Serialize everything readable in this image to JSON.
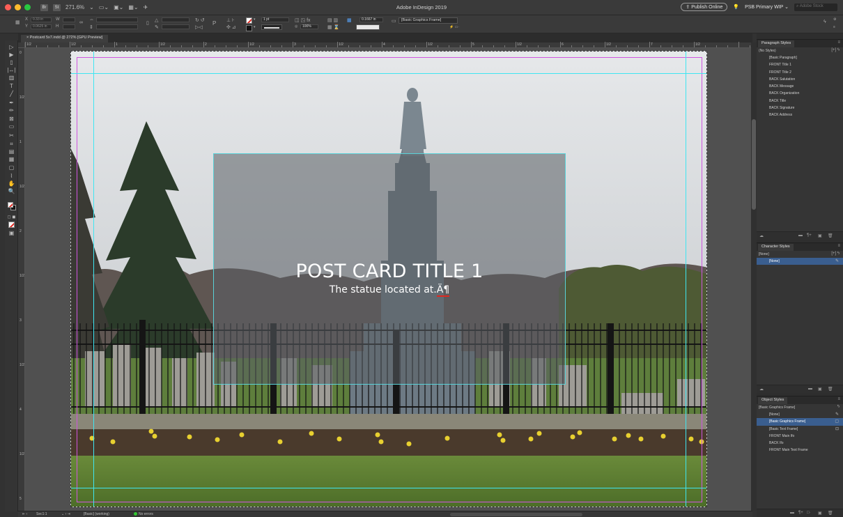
{
  "app": {
    "title": "Adobe InDesign 2019",
    "zoom": "271.6%",
    "publish_label": "Publish Online",
    "workspace": "PSB Primary WIP",
    "search_placeholder": "Adobe Stock"
  },
  "control_bar": {
    "x_value": "0.33 in",
    "y_value": "0.0625 in",
    "stroke_weight": "1 pt",
    "opacity": "100%",
    "offset_value": "0.1667 in",
    "object_style": "[Basic Graphics Frame]"
  },
  "document": {
    "tab_label": "Postcard 5x7.indd @ 272% [GPU Preview]"
  },
  "rulers": {
    "horizontal": [
      "1/2",
      "1/2",
      "1",
      "1/2",
      "2",
      "1/2",
      "3",
      "1/2",
      "4",
      "1/2",
      "5",
      "1/2",
      "6",
      "1/2",
      "7",
      "1/2"
    ],
    "vertical": [
      "0",
      "1/2",
      "1",
      "1/2",
      "2",
      "1/2",
      "3",
      "1/2",
      "4",
      "1/2",
      "5"
    ]
  },
  "canvas": {
    "title": "POST CARD TITLE 1",
    "subtitle": "The statue located at.",
    "subtitle_tail": "Ä¶"
  },
  "status_bar": {
    "page": "Sec1:1",
    "profile": "[Basic] (working)",
    "errors": "No errors"
  },
  "paragraph_styles": {
    "title": "Paragraph Styles",
    "current": "(No Styles)",
    "items": [
      "[Basic Paragraph]",
      "FRONT Title 1",
      "FRONT Title 2",
      "BACK Salutation",
      "BACK Message",
      "BACK Organization",
      "BACK Title",
      "BACK Signature",
      "BACK Address"
    ]
  },
  "character_styles": {
    "title": "Character Styles",
    "current": "[None]",
    "items": [
      "[None]"
    ]
  },
  "object_styles": {
    "title": "Object Styles",
    "current": "[Basic Graphics Frame]",
    "items": [
      "[None]",
      "[Basic Graphics Frame]",
      "[Basic Text Frame]",
      "FRONT Main Ifo",
      "BACK Ifo",
      "FRONT Main Text Frame"
    ]
  },
  "colors": {
    "guide": "#3ee6f2",
    "margin": "#d055e0",
    "selection": "#3a5e8f",
    "stroke_swatch": "#e0271f"
  },
  "icons": [
    "fill-stroke-icon",
    "selection-tool-icon",
    "type-tool-icon",
    "hand-tool-icon",
    "zoom-tool-icon",
    "lightbulb-icon",
    "search-icon",
    "new-style-icon",
    "trash-icon"
  ]
}
